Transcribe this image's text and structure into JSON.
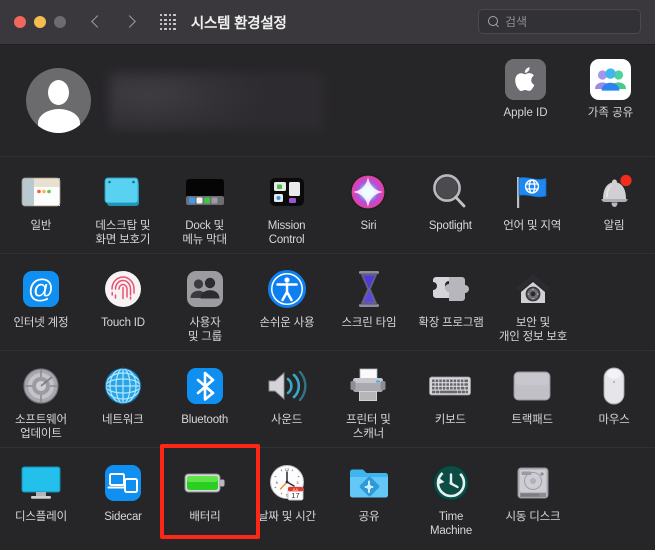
{
  "window": {
    "title": "시스템 환경설정",
    "traffic_lights": [
      "close-button",
      "minimize-button",
      "zoom-button"
    ],
    "colors": {
      "close": "#f2675c",
      "minimize": "#f5bd4f",
      "zoom": "#6c6b6e",
      "titlebar_bg": "#3a383c",
      "body_bg": "#262528",
      "highlight": "#fc2717"
    }
  },
  "toolbar": {
    "back_icon": "chevron-left-icon",
    "forward_icon": "chevron-right-icon",
    "grid_icon": "grid-dots-icon",
    "search": {
      "icon": "search-icon",
      "placeholder": "검색",
      "value": ""
    }
  },
  "account": {
    "avatar_icon": "default-user-avatar-icon",
    "name": "",
    "name_redacted": true,
    "actions": [
      {
        "id": "apple-id",
        "label": "Apple ID",
        "icon": "apple-logo-icon"
      },
      {
        "id": "family-sharing",
        "label": "가족\n공유",
        "icon": "family-sharing-icon"
      }
    ]
  },
  "preferences": {
    "rows": [
      {
        "id": "row-1",
        "items": [
          {
            "id": "general",
            "label": "일반",
            "icon": "general-window-icon"
          },
          {
            "id": "desktop-saver",
            "label": "데스크탑 및\n화면 보호기",
            "icon": "desktop-screensaver-icon"
          },
          {
            "id": "dock-menubar",
            "label": "Dock 및\n메뉴 막대",
            "icon": "dock-menubar-icon"
          },
          {
            "id": "mission-control",
            "label": "Mission\nControl",
            "icon": "mission-control-icon"
          },
          {
            "id": "siri",
            "label": "Siri",
            "icon": "siri-icon"
          },
          {
            "id": "spotlight",
            "label": "Spotlight",
            "icon": "spotlight-icon"
          },
          {
            "id": "language-region",
            "label": "언어 및 지역",
            "icon": "language-region-flag-icon"
          },
          {
            "id": "notifications",
            "label": "알림",
            "icon": "notifications-bell-icon"
          }
        ]
      },
      {
        "id": "row-2",
        "items": [
          {
            "id": "internet-accounts",
            "label": "인터넷 계정",
            "icon": "internet-accounts-at-icon"
          },
          {
            "id": "touch-id",
            "label": "Touch ID",
            "icon": "touch-id-fingerprint-icon"
          },
          {
            "id": "users-groups",
            "label": "사용자\n및 그룹",
            "icon": "users-groups-icon"
          },
          {
            "id": "accessibility",
            "label": "손쉬운 사용",
            "icon": "accessibility-icon"
          },
          {
            "id": "screen-time",
            "label": "스크린 타임",
            "icon": "screen-time-hourglass-icon"
          },
          {
            "id": "extensions",
            "label": "확장 프로그램",
            "icon": "extensions-puzzle-icon"
          },
          {
            "id": "security-privacy",
            "label": "보안 및\n개인 정보 보호",
            "icon": "security-privacy-house-icon"
          }
        ]
      },
      {
        "id": "row-3",
        "items": [
          {
            "id": "software-update",
            "label": "소프트웨어\n업데이트",
            "icon": "software-update-gear-icon"
          },
          {
            "id": "network",
            "label": "네트워크",
            "icon": "network-globe-icon"
          },
          {
            "id": "bluetooth",
            "label": "Bluetooth",
            "icon": "bluetooth-icon"
          },
          {
            "id": "sound",
            "label": "사운드",
            "icon": "sound-speaker-icon"
          },
          {
            "id": "printers",
            "label": "프린터 및\n스캐너",
            "icon": "printer-scanner-icon"
          },
          {
            "id": "keyboard",
            "label": "키보드",
            "icon": "keyboard-icon"
          },
          {
            "id": "trackpad",
            "label": "트랙패드",
            "icon": "trackpad-icon"
          },
          {
            "id": "mouse",
            "label": "마우스",
            "icon": "mouse-icon"
          }
        ]
      },
      {
        "id": "row-4",
        "items": [
          {
            "id": "displays",
            "label": "디스플레이",
            "icon": "display-monitor-icon"
          },
          {
            "id": "sidecar",
            "label": "Sidecar",
            "icon": "sidecar-icon"
          },
          {
            "id": "battery",
            "label": "배터리",
            "icon": "battery-icon",
            "highlighted": true
          },
          {
            "id": "date-time",
            "label": "날짜 및 시간",
            "icon": "date-time-clock-icon"
          },
          {
            "id": "sharing",
            "label": "공유",
            "icon": "sharing-folder-icon"
          },
          {
            "id": "time-machine",
            "label": "Time\nMachine",
            "icon": "time-machine-icon"
          },
          {
            "id": "startup-disk",
            "label": "시동 디스크",
            "icon": "startup-disk-icon"
          }
        ]
      }
    ]
  }
}
